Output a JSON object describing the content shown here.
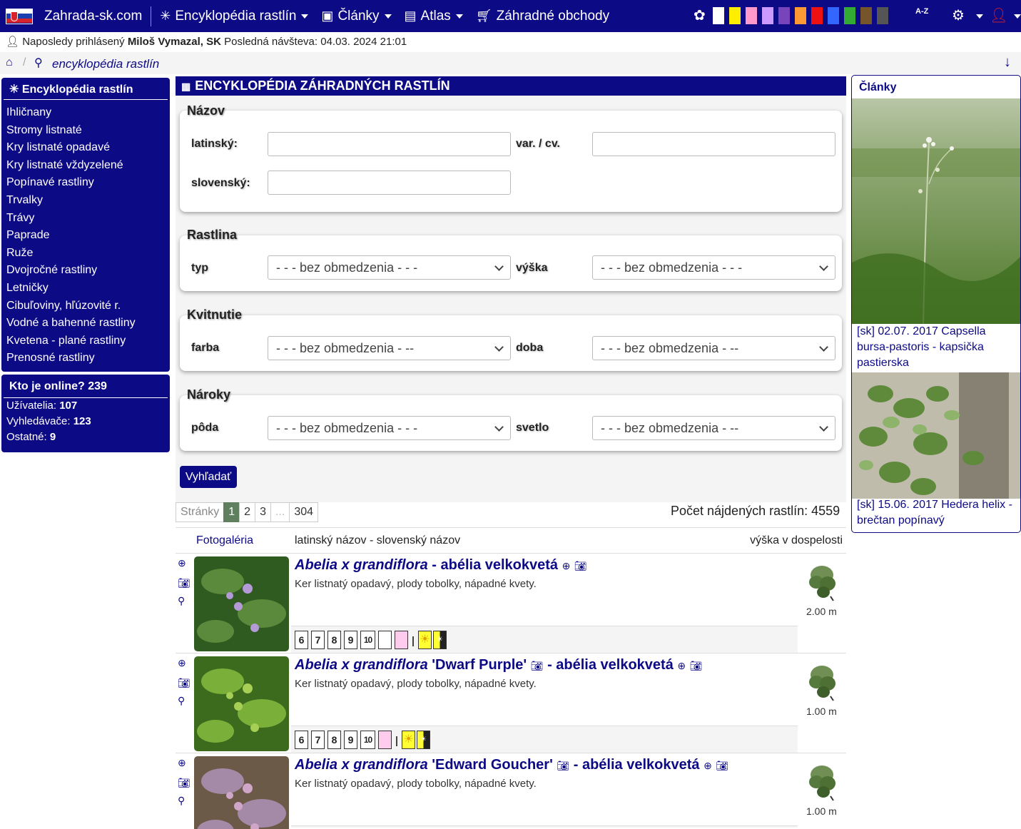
{
  "nav": {
    "brand": "Zahrada-sk.com",
    "items": [
      {
        "label": "Encyklopédia rastlín",
        "icon": "asterisk-icon"
      },
      {
        "label": "Články",
        "icon": "book-icon"
      },
      {
        "label": "Atlas",
        "icon": "atlas-icon"
      },
      {
        "label": "Záhradné obchody",
        "icon": "cart-icon"
      }
    ],
    "color_swatches": [
      "#ffffff",
      "#ffee00",
      "#ff99cc",
      "#cc99ff",
      "#7744bb",
      "#ff9933",
      "#ee1111",
      "#3366ff",
      "#33aa33",
      "#77552a",
      "#555555"
    ],
    "az_label": "A-Z"
  },
  "last_login": {
    "prefix": "Naposledy prihlásený",
    "user": "Miloš Vymazal, SK",
    "suffix": "Posledná návšteva: 04.03. 2024 21:01"
  },
  "breadcrumb": {
    "current": "encyklopédia rastlín"
  },
  "sidebar": {
    "title": "Encyklopédia rastlín",
    "items": [
      "Ihličnany",
      "Stromy listnaté",
      "Kry listnaté opadavé",
      "Kry listnaté vždyzelené",
      "Popínavé rastliny",
      "Trvalky",
      "Trávy",
      "Paprade",
      "Ruže",
      "Dvojročné rastliny",
      "Letničky",
      "Cibuľoviny, hľúzovité r.",
      "Vodné a bahenné rastliny",
      "Kvetena - plané rastliny",
      "Prenosné rastliny"
    ]
  },
  "online": {
    "title": "Kto je online? 239",
    "rows": [
      {
        "label": "Užívatelia:",
        "value": "107"
      },
      {
        "label": "Vyhledávače:",
        "value": "123"
      },
      {
        "label": "Ostatné:",
        "value": "9"
      }
    ]
  },
  "main": {
    "title": "ENCYKLOPÉDIA ZÁHRADNÝCH RASTLÍN",
    "groups": {
      "nazov": {
        "legend": "Názov",
        "latin_label": "latinský:",
        "var_label": "var. / cv.",
        "slovak_label": "slovenský:"
      },
      "rastlina": {
        "legend": "Rastlina",
        "typ_label": "typ",
        "typ_value": "- - - bez obmedzenia - - -",
        "vyska_label": "výška",
        "vyska_value": "- - - bez obmedzenia - - -"
      },
      "kvitnutie": {
        "legend": "Kvitnutie",
        "farba_label": "farba",
        "farba_value": "- - - bez obmedzenia - --",
        "doba_label": "doba",
        "doba_value": "- - - bez obmedzenia - --"
      },
      "naroky": {
        "legend": "Nároky",
        "poda_label": "pôda",
        "poda_value": "- - - bez obmedzenia - - -",
        "svetlo_label": "svetlo",
        "svetlo_value": "- - - bez obmedzenia - --"
      }
    },
    "search_button": "Vyhľadať",
    "pager": {
      "label": "Stránky",
      "pages": [
        "1",
        "2",
        "3",
        "...",
        "304"
      ],
      "current": "1"
    },
    "count": "Počet nájdených rastlín: 4559",
    "table_head": {
      "gallery": "Fotogaléria",
      "name": "latinský názov - slovenský názov",
      "height": "výška v dospelosti"
    },
    "plants": [
      {
        "latin": "Abelia x grandiflora",
        "cultivar": "",
        "slovak": "- abélia velkokvetá",
        "desc": "Ker listnatý opadavý, plody tobolky, nápadné kvety.",
        "months": [
          "6",
          "7",
          "8",
          "9",
          "10"
        ],
        "height": "2.00 m",
        "flower_colors": [
          "#ffffff",
          "#ffccee"
        ]
      },
      {
        "latin": "Abelia x grandiflora",
        "cultivar": "'Dwarf Purple'",
        "slovak": "- abélia velkokvetá",
        "desc": "Ker listnatý opadavý, plody tobolky, nápadné kvety.",
        "months": [
          "6",
          "7",
          "8",
          "9",
          "10"
        ],
        "height": "1.00 m",
        "flower_colors": [
          "#ffccee"
        ]
      },
      {
        "latin": "Abelia x grandiflora",
        "cultivar": "'Edward Goucher'",
        "slovak": "- abélia velkokvetá",
        "desc": "Ker listnatý opadavý, plody tobolky, nápadné kvety.",
        "months": [],
        "height": "1.00 m",
        "flower_colors": []
      }
    ]
  },
  "articles": {
    "title": "Články",
    "items": [
      {
        "caption": "[sk] 02.07. 2017 Capsella bursa-pastoris - kapsička pastierska"
      },
      {
        "caption": "[sk] 15.06. 2017 Hedera helix - brečtan popínavý"
      }
    ]
  }
}
